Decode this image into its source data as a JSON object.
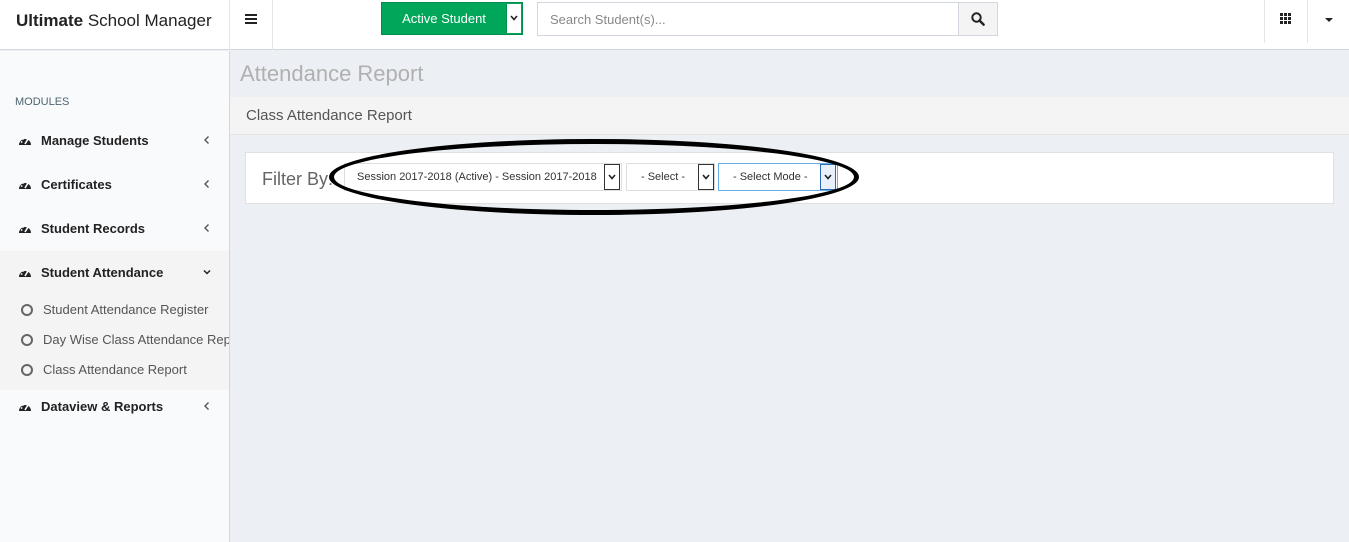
{
  "header": {
    "brand_bold": "Ultimate",
    "brand_rest": "School Manager",
    "active_student_label": "Active Student",
    "search_placeholder": "Search Student(s)..."
  },
  "sidebar": {
    "section_header": "MODULES",
    "items": [
      {
        "label": "Manage Students"
      },
      {
        "label": "Certificates"
      },
      {
        "label": "Student Records"
      },
      {
        "label": "Student Attendance"
      },
      {
        "label": "Dataview & Reports"
      }
    ],
    "sub_items": [
      {
        "label": "Student Attendance Register"
      },
      {
        "label": "Day Wise Class Attendance Report"
      },
      {
        "label": "Class Attendance Report"
      }
    ]
  },
  "main": {
    "page_title": "Attendance Report",
    "box_title": "Class Attendance Report",
    "filter": {
      "label": "Filter By:",
      "session_value": "Session 2017-2018 (Active) - Session 2017-2018",
      "class_value": "- Select -",
      "mode_value": "- Select Mode -"
    }
  },
  "colors": {
    "accent_green": "#00a65a",
    "content_bg": "#ecf0f5",
    "annotation": "#000000"
  }
}
